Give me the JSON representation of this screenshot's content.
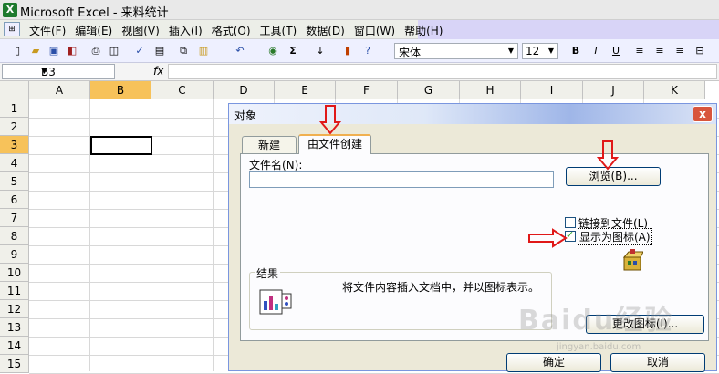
{
  "window": {
    "title": "Microsoft Excel - 来料统计",
    "app_icon": "excel-icon"
  },
  "menubar": {
    "items": [
      "文件(F)",
      "编辑(E)",
      "视图(V)",
      "插入(I)",
      "格式(O)",
      "工具(T)",
      "数据(D)",
      "窗口(W)",
      "帮助(H)"
    ]
  },
  "toolbar": {
    "font_name": "宋体",
    "font_size": "12",
    "bold": "B",
    "italic": "I",
    "underline": "U",
    "sum": "Σ"
  },
  "formula_bar": {
    "cell_ref": "B3",
    "fx": "fx",
    "value": ""
  },
  "grid": {
    "columns": [
      "A",
      "B",
      "C",
      "D",
      "E",
      "F",
      "G",
      "H",
      "I",
      "J",
      "K"
    ],
    "rows": [
      "1",
      "2",
      "3",
      "4",
      "5",
      "6",
      "7",
      "8",
      "9",
      "10",
      "11",
      "12",
      "13",
      "14",
      "15"
    ],
    "selected_column": "B",
    "selected_row": "3"
  },
  "dialog": {
    "title": "对象",
    "close": "x",
    "tabs": [
      "新建",
      "由文件创建"
    ],
    "active_tab": "由文件创建",
    "filename_label": "文件名(N):",
    "filename_value": "",
    "browse_button": "浏览(B)...",
    "link_checkbox": {
      "label": "链接到文件(L)",
      "checked": false
    },
    "icon_checkbox": {
      "label": "显示为图标(A)",
      "checked": true
    },
    "result_label": "结果",
    "result_text": "将文件内容插入文档中，并以图标表示。",
    "change_icon_button": "更改图标(I)...",
    "ok_button": "确定",
    "cancel_button": "取消"
  },
  "annotations": {
    "arrow_color": "#e01818"
  },
  "watermark": {
    "text": "Baidu经验",
    "subtext": "jingyan.baidu.com"
  }
}
